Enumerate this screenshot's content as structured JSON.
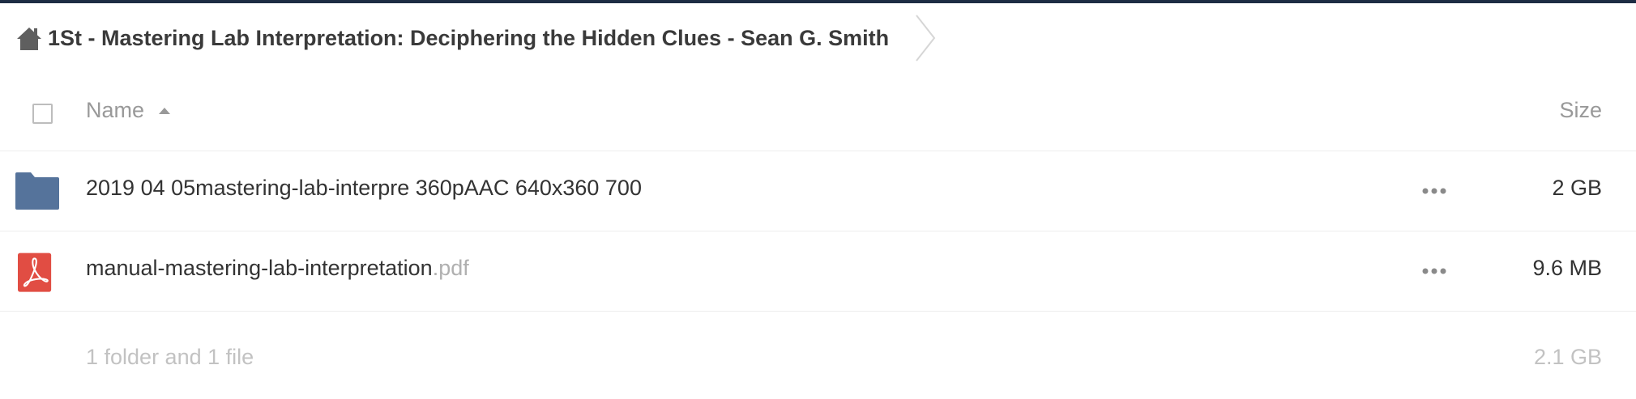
{
  "breadcrumb": {
    "title": "1St - Mastering Lab Interpretation: Deciphering the Hidden Clues - Sean G. Smith",
    "home_icon": "home-icon",
    "separator_icon": "chevron-right-icon"
  },
  "table": {
    "headers": {
      "name": "Name",
      "size": "Size",
      "sort": "ascending"
    },
    "rows": [
      {
        "type": "folder",
        "icon": "folder-icon",
        "name": "2019 04 05mastering-lab-interpre 360pAAC 640x360 700",
        "ext": "",
        "size": "2 GB"
      },
      {
        "type": "file",
        "icon": "pdf-icon",
        "name": "manual-mastering-lab-interpretation",
        "ext": ".pdf",
        "size": "9.6 MB"
      }
    ]
  },
  "summary": {
    "text": "1 folder and 1 file",
    "size": "2.1 GB"
  },
  "colors": {
    "topbar": "#1d2d44",
    "folder": "#55739b",
    "pdf": "#e14d43"
  }
}
